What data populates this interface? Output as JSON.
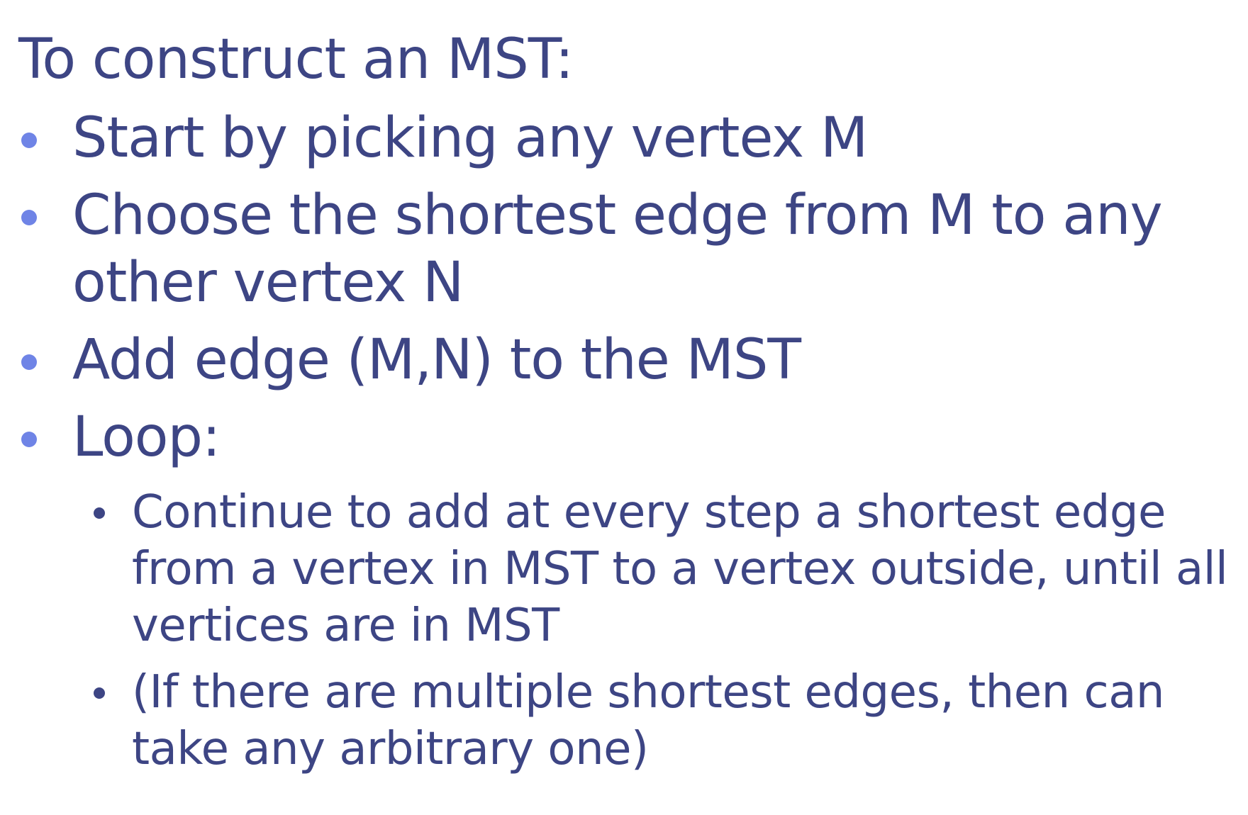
{
  "slide": {
    "heading": "To construct an MST:",
    "bullets": [
      "Start by picking any vertex M",
      "Choose the shortest edge from M to any other vertex N",
      "Add edge (M,N) to the MST",
      "Loop:"
    ],
    "sub_bullets": [
      "Continue to add at every step a shortest edge from a vertex in MST to a vertex outside, until all vertices are in MST",
      "(If there are multiple shortest edges, then can take any arbitrary one)"
    ]
  },
  "colors": {
    "text": "#3d4584",
    "bullet_level1": "#6f84e6",
    "bullet_level2": "#3d4584",
    "accent_mark": "#c0392b"
  }
}
